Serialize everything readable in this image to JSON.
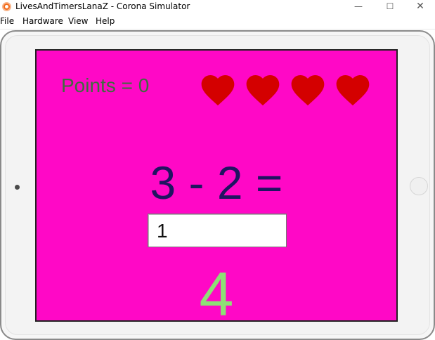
{
  "window": {
    "title": "LivesAndTimersLanaZ - Corona Simulator",
    "minimize_glyph": "—",
    "maximize_glyph": "☐",
    "close_glyph": "✕"
  },
  "menu": {
    "items": [
      "File",
      "Hardware",
      "View",
      "Help"
    ]
  },
  "game": {
    "points_text": "Points = 0",
    "lives": 4,
    "heart_color": "#d40000",
    "question": "3 - 2 =",
    "answer_value": "1",
    "result_number": "4",
    "colors": {
      "background": "#ff08c6",
      "points": "#3f6b3f",
      "question": "#1f1461",
      "result": "#8edf76"
    }
  }
}
